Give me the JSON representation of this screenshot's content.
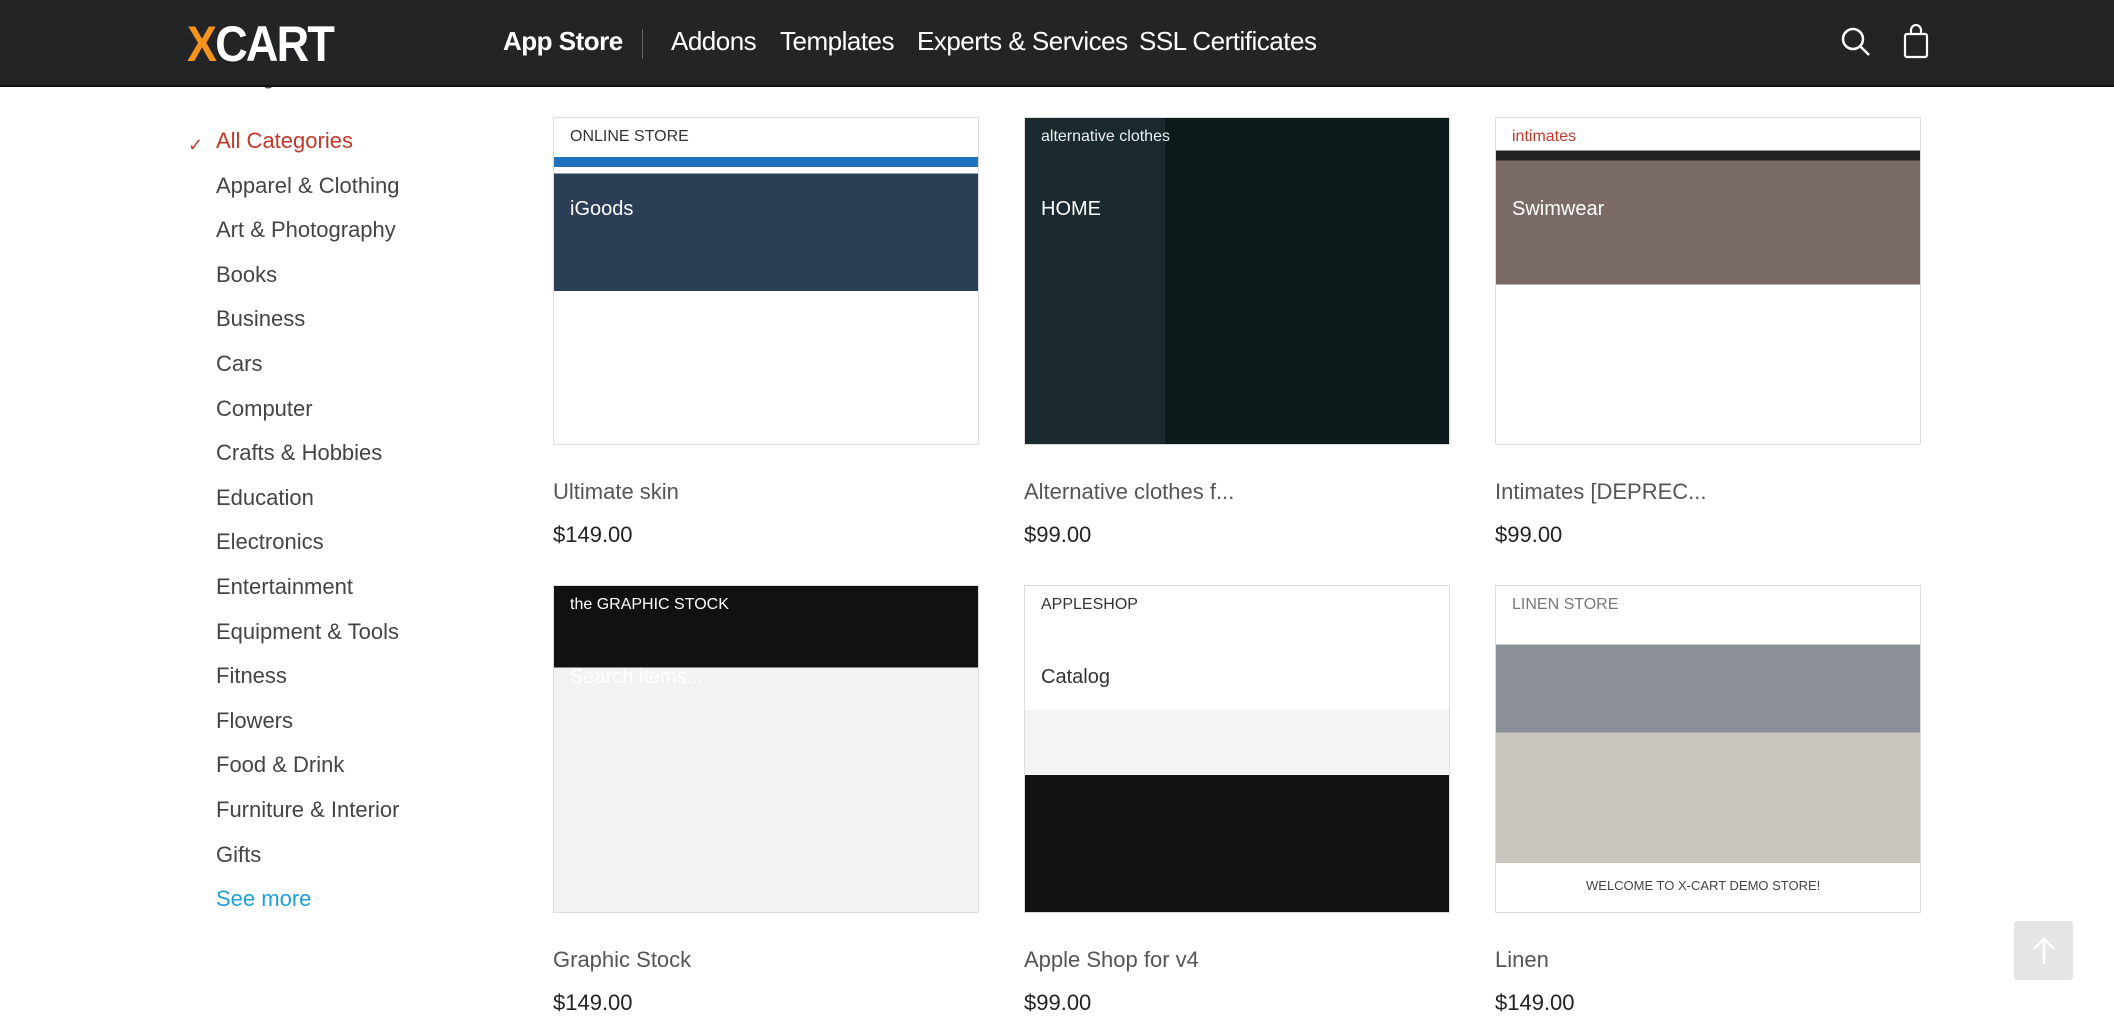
{
  "header": {
    "logo": "XCART",
    "nav": [
      {
        "label": "App Store",
        "active": true
      },
      {
        "label": "Addons"
      },
      {
        "label": "Templates"
      },
      {
        "label": "Experts & Services"
      },
      {
        "label": "SSL Certificates"
      }
    ],
    "icons": [
      "search-icon",
      "shopping-bag-icon"
    ]
  },
  "sidebar": {
    "heading": "Categories",
    "items": [
      {
        "label": "All Categories",
        "active": true
      },
      {
        "label": "Apparel & Clothing"
      },
      {
        "label": "Art & Photography"
      },
      {
        "label": "Books"
      },
      {
        "label": "Business"
      },
      {
        "label": "Cars"
      },
      {
        "label": "Computer"
      },
      {
        "label": "Crafts & Hobbies"
      },
      {
        "label": "Education"
      },
      {
        "label": "Electronics"
      },
      {
        "label": "Entertainment"
      },
      {
        "label": "Equipment & Tools"
      },
      {
        "label": "Fitness"
      },
      {
        "label": "Flowers"
      },
      {
        "label": "Food & Drink"
      },
      {
        "label": "Furniture & Interior"
      },
      {
        "label": "Gifts"
      }
    ],
    "see_more": "See more"
  },
  "products": [
    {
      "title": "Ultimate skin",
      "price": "$149.00",
      "thumb_text": "ONLINE STORE",
      "thumb_sub": "iGoods"
    },
    {
      "title": "Alternative clothes f...",
      "price": "$99.00",
      "thumb_text": "alternative clothes",
      "thumb_sub": "HOME"
    },
    {
      "title": "Intimates [DEPREC...",
      "price": "$99.00",
      "thumb_text": "intimates",
      "thumb_sub": "Swimwear"
    },
    {
      "title": "Graphic Stock",
      "price": "$149.00",
      "thumb_text": "the GRAPHIC STOCK",
      "thumb_sub": "Search items..."
    },
    {
      "title": "Apple Shop for v4",
      "price": "$99.00",
      "thumb_text": "APPLESHOP",
      "thumb_sub": "Catalog"
    },
    {
      "title": "Linen",
      "price": "$149.00",
      "thumb_text": "LINEN STORE",
      "thumb_sub": "WELCOME TO X-CART DEMO STORE!"
    }
  ],
  "colors": {
    "header_bg": "#232425",
    "logo_accent": "#f7941d",
    "active_category": "#c0392b",
    "link": "#1e9fd8"
  }
}
